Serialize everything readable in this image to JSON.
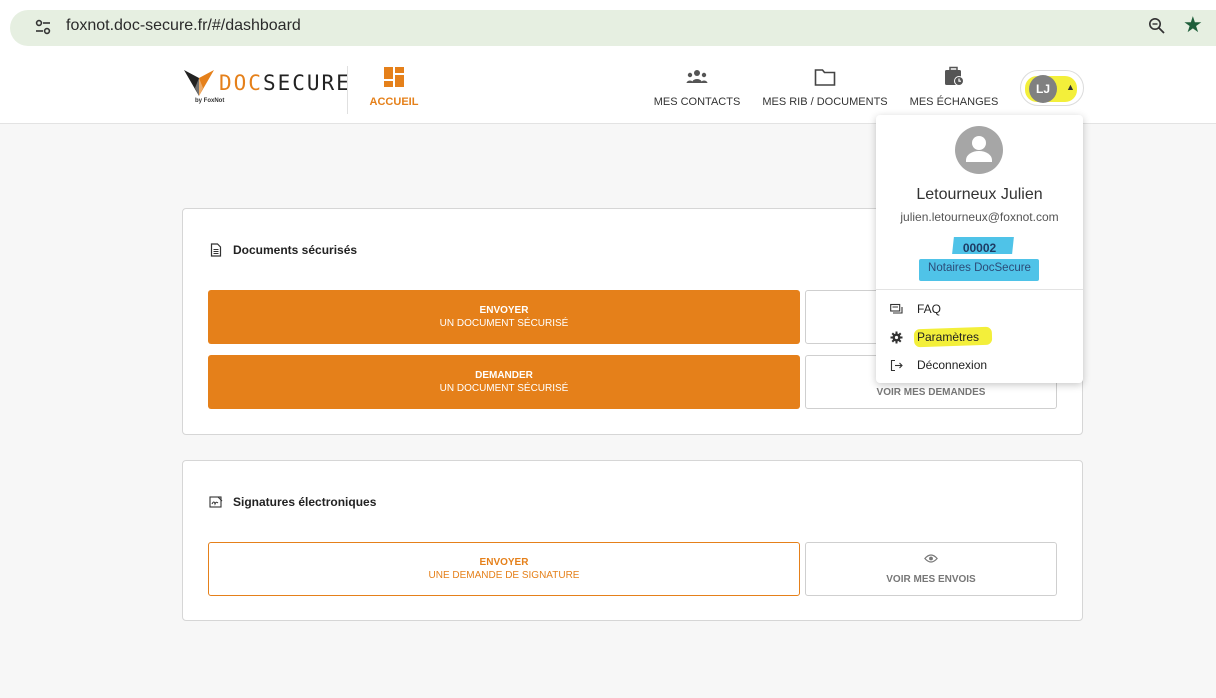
{
  "browser": {
    "url": "foxnot.doc-secure.fr/#/dashboard"
  },
  "brand": {
    "logo_prefix": "DOC",
    "logo_suffix": "SECURE",
    "logo_sub": "by FoxNot",
    "accent_color": "#e5801a"
  },
  "nav": {
    "home": "ACCUEIL",
    "contacts": "MES CONTACTS",
    "rib_documents": "MES RIB / DOCUMENTS",
    "echanges": "MES ÉCHANGES"
  },
  "user": {
    "initials": "LJ",
    "name": "Letourneux Julien",
    "email": "julien.letourneux@foxnot.com",
    "code": "00002",
    "team": "Notaires DocSecure"
  },
  "menu": {
    "faq": "FAQ",
    "settings": "Paramètres",
    "logout": "Déconnexion"
  },
  "secure_docs": {
    "title": "Documents sécurisés",
    "send_line1": "ENVOYER",
    "send_line2": "UN DOCUMENT SÉCURISÉ",
    "request_line1": "DEMANDER",
    "request_line2": "UN DOCUMENT SÉCURISÉ",
    "view_requests": "VOIR MES DEMANDES"
  },
  "signatures": {
    "title": "Signatures électroniques",
    "send_line1": "ENVOYER",
    "send_line2": "UNE DEMANDE DE SIGNATURE",
    "view_sends": "VOIR MES ENVOIS"
  }
}
